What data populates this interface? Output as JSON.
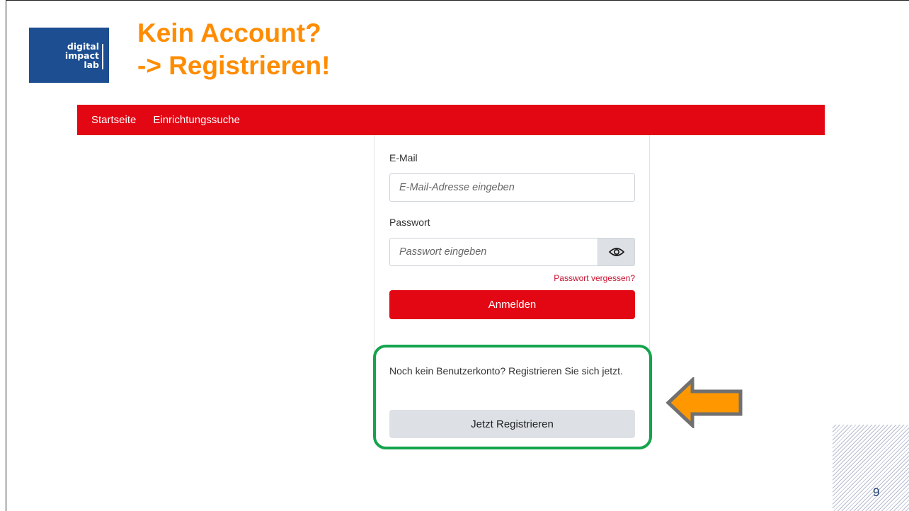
{
  "slide": {
    "logo_lines": [
      "digital",
      "impact",
      "lab"
    ],
    "title_line1": "Kein Account?",
    "title_line2": "-> Registrieren!",
    "page_number": "9"
  },
  "navbar": {
    "items": [
      "Startseite",
      "Einrichtungssuche"
    ]
  },
  "login_form": {
    "email_label": "E-Mail",
    "email_placeholder": "E-Mail-Adresse eingeben",
    "password_label": "Passwort",
    "password_placeholder": "Passwort eingeben",
    "toggle_icon": "eye-icon",
    "forgot_link": "Passwort vergessen?",
    "login_button": "Anmelden"
  },
  "register": {
    "prompt": "Noch kein Benutzerkonto? Registrieren Sie sich jetzt.",
    "button": "Jetzt Registrieren"
  },
  "colors": {
    "title": "#ff8c00",
    "brand_red": "#e30613",
    "highlight_green": "#14a44d",
    "arrow_orange": "#ff9800",
    "logo_blue": "#1d4e91"
  }
}
